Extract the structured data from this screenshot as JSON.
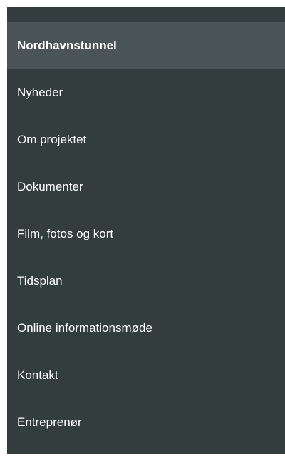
{
  "menu": {
    "header_label": "Nordhavnstunnel",
    "items": [
      {
        "label": "Nyheder"
      },
      {
        "label": "Om projektet"
      },
      {
        "label": "Dokumenter"
      },
      {
        "label": "Film, fotos og kort"
      },
      {
        "label": "Tidsplan"
      },
      {
        "label": "Online informationsmøde"
      },
      {
        "label": "Kontakt"
      },
      {
        "label": "Entreprenør"
      }
    ]
  },
  "colors": {
    "panel_background": "#333d3e",
    "header_background": "#4a5457",
    "text": "#ffffff"
  }
}
